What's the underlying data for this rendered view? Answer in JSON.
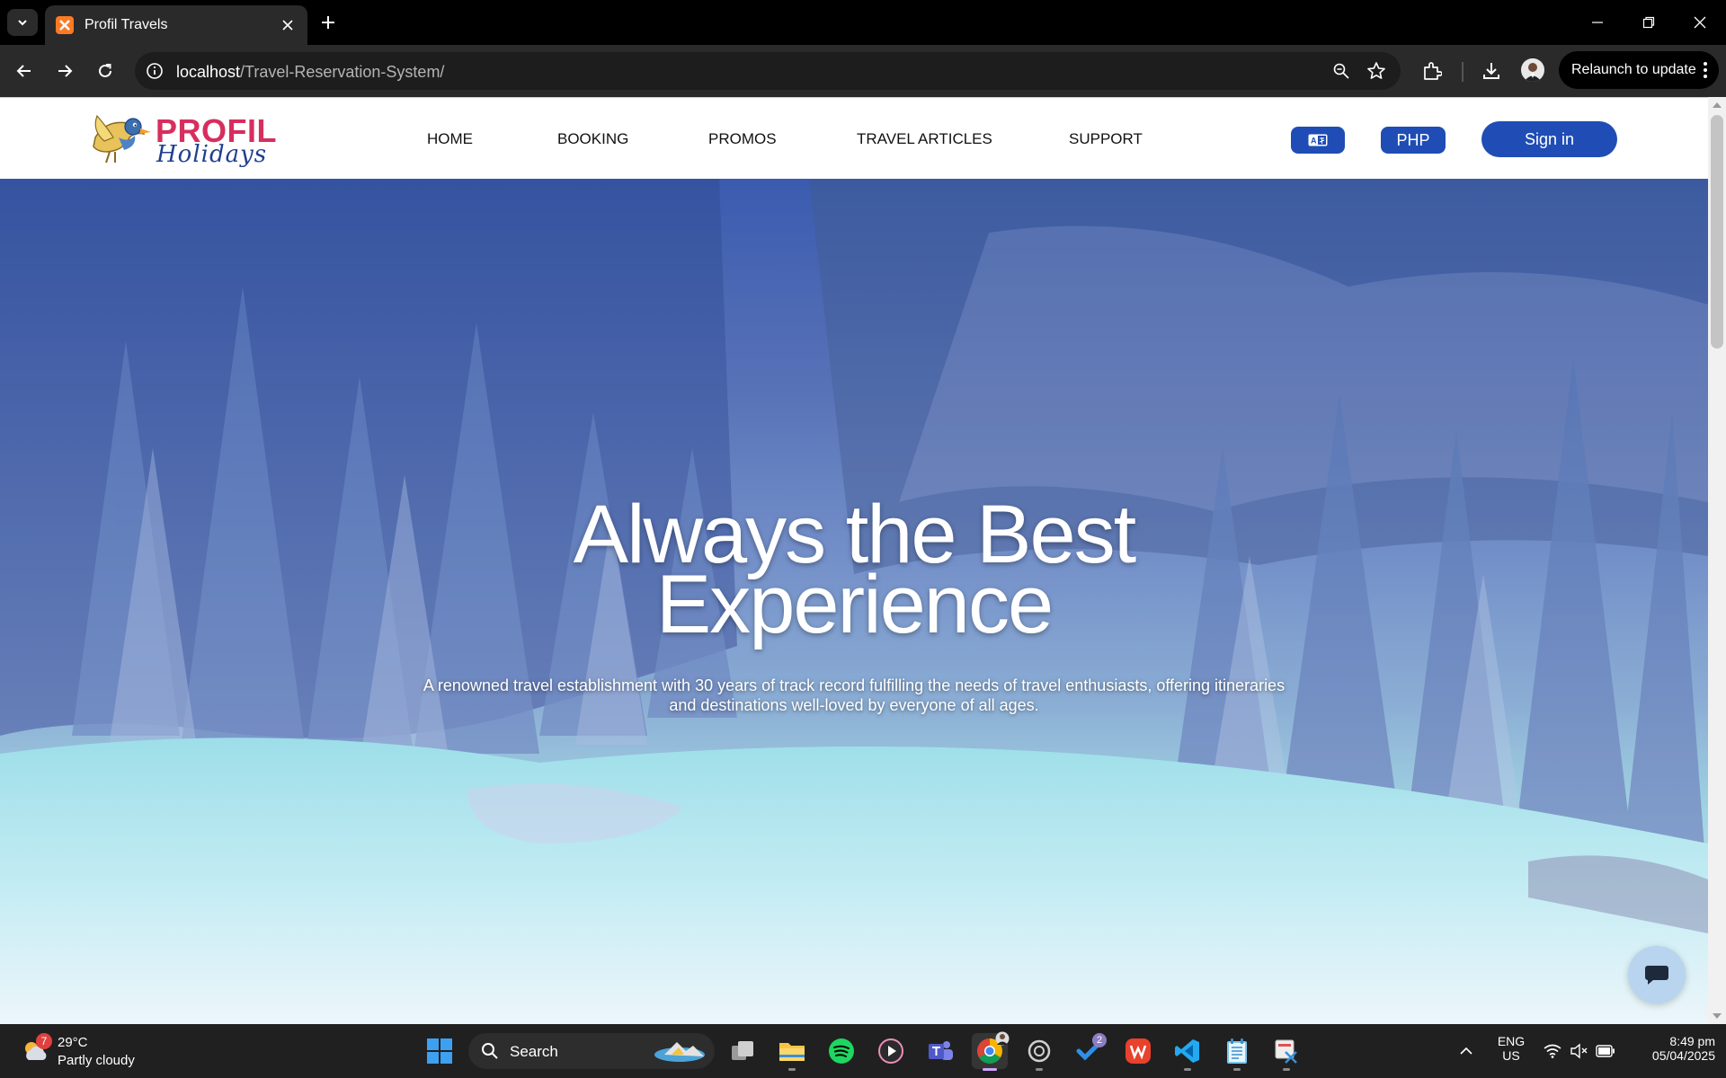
{
  "browser": {
    "tab_title": "Profil Travels",
    "url_host": "localhost",
    "url_path": "/Travel-Reservation-System/",
    "relaunch_label": "Relaunch to update",
    "icons": [
      "tab-list-icon",
      "new-tab-icon",
      "minimize-icon",
      "restore-icon",
      "close-icon",
      "back-icon",
      "forward-icon",
      "reload-icon",
      "site-info-icon",
      "zoom-icon",
      "bookmark-star-icon",
      "extensions-icon",
      "downloads-icon",
      "profile-avatar",
      "menu-dots-icon"
    ]
  },
  "site": {
    "logo": {
      "brand": "PROFIL",
      "sub": "Holidays"
    },
    "nav": [
      "HOME",
      "BOOKING",
      "PROMOS",
      "TRAVEL ARTICLES",
      "SUPPORT"
    ],
    "language_icon": "translate-icon",
    "currency_label": "PHP",
    "signin_label": "Sign in",
    "hero": {
      "title_line1": "Always the Best",
      "title_line2": "Experience",
      "subtitle": "A renowned travel establishment with 30 years of track record fulfilling the needs of travel enthusiasts, offering itineraries and destinations well-loved by everyone of all ages."
    },
    "chat_icon": "chat-bubble-icon"
  },
  "taskbar": {
    "weather": {
      "badge": "7",
      "temp": "29°C",
      "condition": "Partly cloudy"
    },
    "search_label": "Search",
    "apps": [
      "windows-start",
      "file-explorer",
      "task-view",
      "spotify",
      "media-player",
      "teams",
      "chrome",
      "app-ring",
      "todo",
      "wps-office",
      "vscode",
      "notepad",
      "snipping-tool"
    ],
    "todo_count": "2",
    "lang_line1": "ENG",
    "lang_line2": "US",
    "time": "8:49 pm",
    "date": "05/04/2025"
  },
  "colors": {
    "brand_pink": "#d72e5e",
    "brand_blue": "#1f4db5",
    "chrome_dark": "#2a2a2a",
    "taskbar": "#202020"
  }
}
